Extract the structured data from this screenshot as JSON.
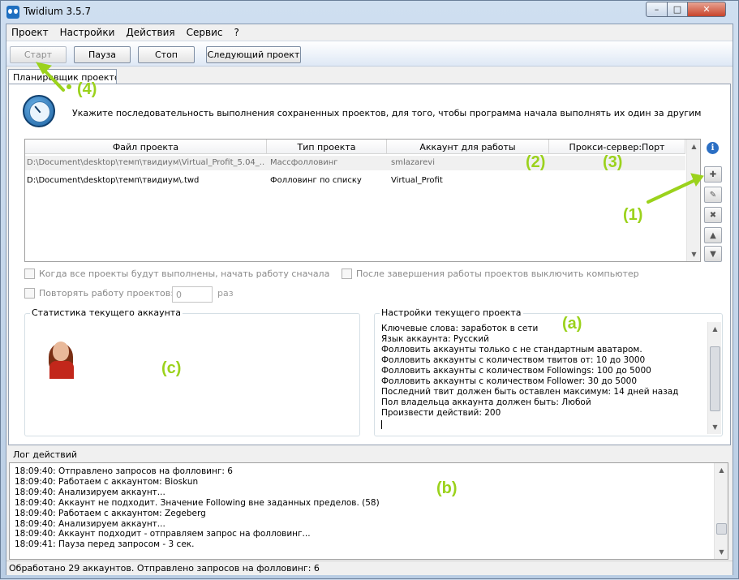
{
  "window": {
    "title": "Twidium 3.5.7",
    "min_glyph": "–",
    "max_glyph": "□",
    "close_glyph": "✕"
  },
  "menu": {
    "items": [
      "Проект",
      "Настройки",
      "Действия",
      "Сервис",
      "?"
    ]
  },
  "toolbar": {
    "start_label": "Старт",
    "pause_label": "Пауза",
    "stop_label": "Стоп",
    "next_label": "Следующий проект"
  },
  "tab": {
    "label": "Планировщик проектов"
  },
  "scheduler": {
    "description": "Укажите последовательность выполнения сохраненных проектов, для того, чтобы программа начала выполнять их один за другим",
    "columns": [
      "Файл проекта",
      "Тип проекта",
      "Аккаунт для работы",
      "Прокси-сервер:Порт"
    ],
    "rows": [
      {
        "file": "D:\\Document\\desktop\\темп\\твидиум\\Virtual_Profit_5.04_...",
        "type": "Массфолловинг",
        "account": "smlazarevi",
        "proxy": ""
      },
      {
        "file": "D:\\Document\\desktop\\темп\\твидиум\\.twd",
        "type": "Фолловинг по списку",
        "account": "Virtual_Profit",
        "proxy": ""
      }
    ],
    "info_glyph": "i"
  },
  "options": {
    "restart_label": "Когда все проекты будут выполнены, начать работу сначала",
    "shutdown_label": "После завершения работы проектов выключить компьютер",
    "repeat_label": "Повторять работу проектов:",
    "repeat_value": "0",
    "repeat_suffix": "раз"
  },
  "stats": {
    "title": "Статистика текущего аккаунта"
  },
  "settings": {
    "title": "Настройки текущего проекта",
    "lines": [
      "Ключевые слова: заработок в сети",
      "Язык аккаунта: Русский",
      "Фолловить аккаунты только с не стандартным аватаром.",
      "Фолловить аккаунты с количеством твитов от: 10 до 3000",
      "Фолловить аккаунты с количеством Followings: 100 до 5000",
      "Фолловить аккаунты с количеством Follower: 30 до 5000",
      "Последний твит должен быть оставлен максимум: 14 дней назад",
      "Пол владельца аккаунта должен быть: Любой",
      "Произвести действий: 200"
    ]
  },
  "log": {
    "label": "Лог действий",
    "lines": [
      "18:09:40: Отправлено запросов на фолловинг: 6",
      "18:09:40: Работаем с аккаунтом: Bioskun",
      "18:09:40: Анализируем аккаунт...",
      "18:09:40: Аккаунт не подходит. Значение Following вне заданных пределов. (58)",
      "18:09:40: Работаем с аккаунтом: Zegeberg",
      "18:09:40: Анализируем аккаунт...",
      "18:09:40: Аккаунт подходит - отправляем запрос на фолловинг...",
      "18:09:41: Пауза перед запросом - 3 сек."
    ]
  },
  "status": {
    "text": "Обработано 29 аккаунтов. Отправлено запросов на фолловинг: 6"
  },
  "annotations": {
    "a1": "(1)",
    "a2": "(2)",
    "a3": "(3)",
    "a4": "(4)",
    "aa": "(a)",
    "ab": "(b)",
    "ac": "(c)",
    "color": "#9bd21c"
  }
}
